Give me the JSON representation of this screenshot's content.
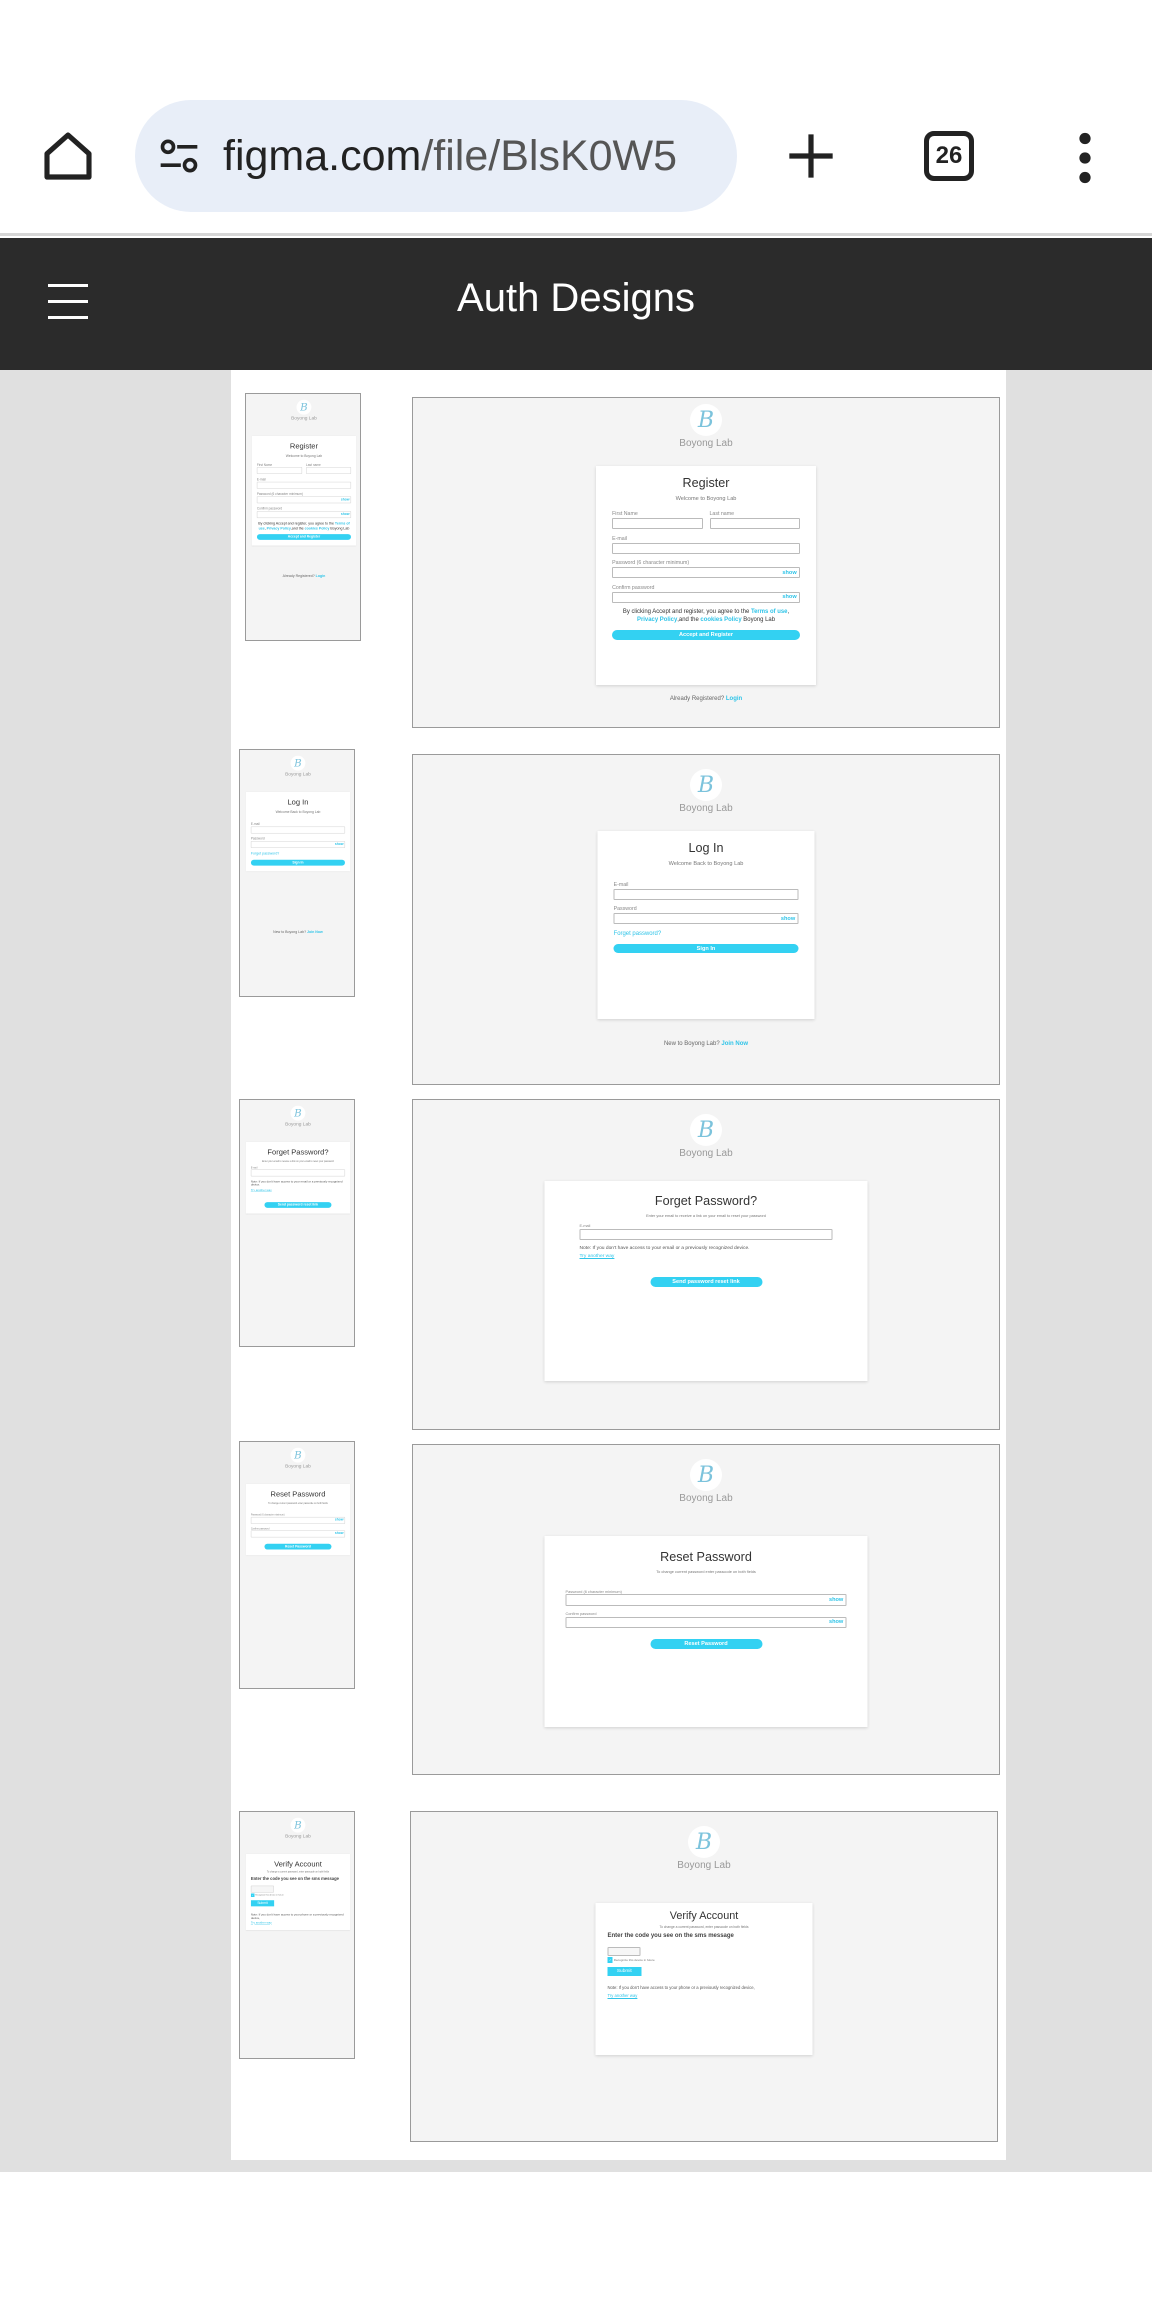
{
  "browser": {
    "url_host": "figma.com",
    "url_path": "/file/BlsK0W5",
    "tab_count": "26"
  },
  "app": {
    "title": "Auth Designs"
  },
  "brand": {
    "name": "Boyong Lab",
    "logo_letter": "B"
  },
  "colors": {
    "accent": "#33d1f2",
    "header": "#2b2b2b",
    "canvas": "#e0e0e0"
  },
  "register": {
    "title": "Register",
    "subtitle": "Welcome to Boyong Lab",
    "first_name": "First Name",
    "last_name": "Last name",
    "email": "E-mail",
    "password": "Password (6 character minimum)",
    "confirm": "Confirm password",
    "show": "show",
    "terms_1": "By clicking Accept and register, you agree to the ",
    "terms_link1": "Terms of use",
    "terms_2": ", ",
    "terms_link2": "Privacy Policy",
    "terms_3": ",and the ",
    "terms_link3": "cookies Policy",
    "terms_4": " Boyong Lab",
    "button": "Accept and Register",
    "footer": "Already Registered?",
    "footer_link": "Login"
  },
  "login": {
    "title": "Log In",
    "subtitle": "Welcome Back to Boyong Lab",
    "email": "E-mail",
    "password": "Password",
    "show": "show",
    "forgot": "Forget password?",
    "button": "Sign In",
    "footer": "New to Boyong Lab?",
    "footer_link": "Join Now"
  },
  "forgot": {
    "title": "Forget Password?",
    "subtitle": "Enter your email to receive a link on your email to reset your password",
    "email": "E-mail",
    "note": "Note: If you don't have access to your email or a previously recognized device.",
    "try": "Try another way",
    "button": "Send password reset link"
  },
  "reset": {
    "title": "Reset Password",
    "subtitle": "To change current password enter passcode on both fields",
    "password": "Password (6 character minimum)",
    "confirm": "Confirm password",
    "show": "show",
    "button": "Reset Password"
  },
  "verify": {
    "title": "Verify Account",
    "subtitle": "To change a current password, enter passcode on both fields",
    "heading": "Enter the code you see on the sms message",
    "remember": "Recognize this device in future",
    "button": "Submit",
    "note": "Note: If you don't have access to your phone or a previously recognized device,",
    "try": "Try another way"
  }
}
